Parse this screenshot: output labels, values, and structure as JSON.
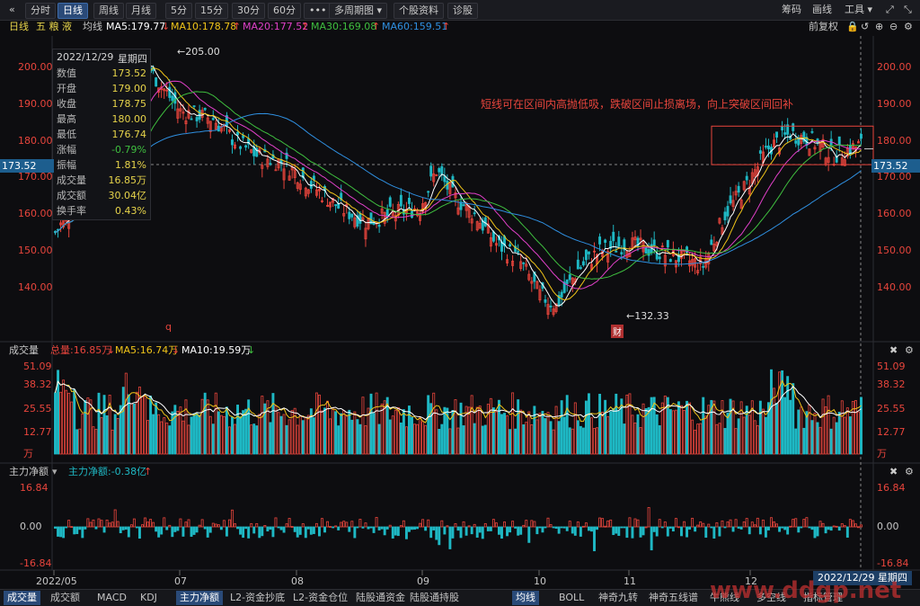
{
  "toolbar": {
    "back_icon": "double-left-icon",
    "periods": [
      "分时",
      "日线",
      "周线",
      "月线",
      "5分",
      "15分",
      "30分",
      "60分"
    ],
    "active_period": "日线",
    "more_label": "•••",
    "multi_period_label": "多周期图",
    "stock_info_label": "个股资料",
    "diagnose_label": "诊股",
    "chips_label": "筹码",
    "draw_label": "画线",
    "tools_label": "工具"
  },
  "header": {
    "period": "日线",
    "stock_name": "五 粮 液",
    "ma_label": "均线",
    "ma5": "MA5:179.77",
    "ma10": "MA10:178.78",
    "ma20": "MA20:177.52",
    "ma30": "MA30:169.08",
    "ma60": "MA60:159.51",
    "adjust_label": "前复权"
  },
  "infobox": {
    "date": "2022/12/29",
    "weekday": "星期四",
    "rows": [
      {
        "k": "数值",
        "v": "173.52"
      },
      {
        "k": "开盘",
        "v": "179.00"
      },
      {
        "k": "收盘",
        "v": "178.75"
      },
      {
        "k": "最高",
        "v": "180.00"
      },
      {
        "k": "最低",
        "v": "176.74"
      },
      {
        "k": "涨幅",
        "v": "-0.79%"
      },
      {
        "k": "振幅",
        "v": "1.81%"
      },
      {
        "k": "成交量",
        "v": "16.85万"
      },
      {
        "k": "成交额",
        "v": "30.04亿"
      },
      {
        "k": "换手率",
        "v": "0.43%"
      }
    ]
  },
  "annotation": "短线可在区间内高抛低吸，跌破区间止损离场，向上突破区间回补",
  "markers": {
    "high": "205.00",
    "low": "132.33",
    "q_mark": "q",
    "fin_mark": "财"
  },
  "crosshair_price": "173.52",
  "volume_header": {
    "title": "成交量",
    "total": "总量:16.85万",
    "ma5": "MA5:16.74万",
    "ma10": "MA10:19.59万"
  },
  "flow_header": {
    "title": "主力净额",
    "value": "主力净额:-0.38亿"
  },
  "date_box": "2022/12/29 星期四",
  "watermark": "www.ddgp.net",
  "bottom_tabs_left": [
    "成交量",
    "成交额",
    "MACD",
    "KDJ",
    "主力净额",
    "L2-资金抄底",
    "L2-资金仓位",
    "陆股通资金",
    "陆股通持股"
  ],
  "bottom_tabs_right": [
    "均线",
    "BOLL",
    "神奇九转",
    "神奇五线谱",
    "牛熊线",
    "多空线",
    "指标管理"
  ],
  "colors": {
    "up": "#e8453c",
    "down": "#1fb8c4",
    "ma5": "#ffffff",
    "ma10": "#f0c419",
    "ma20": "#e040c8",
    "ma30": "#3fbf3f",
    "ma60": "#2f8fe0"
  },
  "chart_data": [
    {
      "type": "candlestick",
      "title": "五粮液 日线",
      "y_ticks": [
        "200.00",
        "190.00",
        "180.00",
        "170.00",
        "160.00",
        "150.00",
        "140.00"
      ],
      "ylim": [
        132,
        207
      ],
      "x_ticks": [
        "2022/05",
        "07",
        "08",
        "09",
        "10",
        "11",
        "12"
      ],
      "box_range": [
        173.5,
        184
      ],
      "series": [
        {
          "name": "日线",
          "values": []
        }
      ]
    },
    {
      "type": "bar",
      "title": "成交量",
      "y_ticks": [
        "51.09",
        "38.32",
        "25.55",
        "12.77",
        "万"
      ],
      "ylim": [
        0,
        51.09
      ]
    },
    {
      "type": "bar",
      "title": "主力净额",
      "y_ticks": [
        "16.84",
        "0.00",
        "-16.84"
      ],
      "ylim": [
        -16.84,
        16.84
      ]
    }
  ]
}
